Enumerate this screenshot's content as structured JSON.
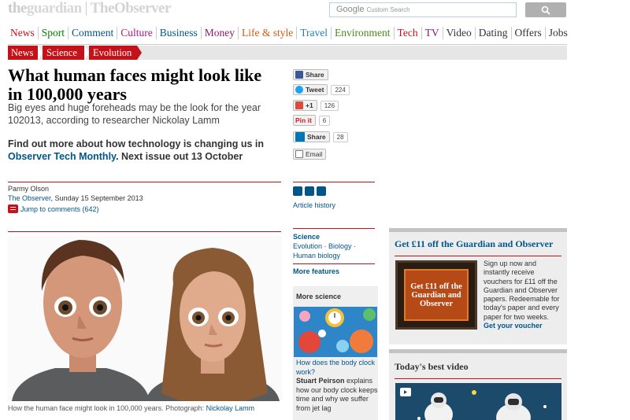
{
  "header": {
    "logo_the": "the",
    "logo_name": "guardian",
    "logo_observer": "TheObserver",
    "search_brand": "Google",
    "search_placeholder": "Custom Search"
  },
  "nav": [
    {
      "label": "News",
      "color": "#c3121a"
    },
    {
      "label": "Sport",
      "color": "#008000"
    },
    {
      "label": "Comment",
      "color": "#005689"
    },
    {
      "label": "Culture",
      "color": "#b3158a"
    },
    {
      "label": "Business",
      "color": "#005689"
    },
    {
      "label": "Money",
      "color": "#8e1b6b"
    },
    {
      "label": "Life & style",
      "color": "#d35a14"
    },
    {
      "label": "Travel",
      "color": "#1b7fc1"
    },
    {
      "label": "Environment",
      "color": "#4a8a1c"
    },
    {
      "label": "Tech",
      "color": "#c3121a"
    },
    {
      "label": "TV",
      "color": "#8a1a6e"
    },
    {
      "label": "Video",
      "color": "#333333"
    },
    {
      "label": "Dating",
      "color": "#333333"
    },
    {
      "label": "Offers",
      "color": "#333333"
    },
    {
      "label": "Jobs",
      "color": "#333333"
    }
  ],
  "breadcrumbs": [
    "News",
    "Science",
    "Evolution"
  ],
  "article": {
    "headline": "What human faces might look like in 100,000 years",
    "standfirst": "Big eyes and huge foreheads may be the look for the year 102013, according to researcher Nickolay Lamm",
    "promo_pre": "Find out more about how technology is changing us in ",
    "promo_link": "Observer Tech Monthly",
    "promo_post": ". Next issue out 13 October",
    "author": "Parmy Olson",
    "publication": "The Observer",
    "date": ", Sunday 15 September 2013",
    "jump_to_comments": "Jump to comments (642)",
    "caption_pre": "How the human face might look in 100,000 years. Photograph: ",
    "caption_credit": "Nickolay Lamm"
  },
  "share": {
    "facebook": "Share",
    "twitter": "Tweet",
    "twitter_count": "224",
    "googleplus": "+1",
    "googleplus_count": "126",
    "pinterest": "Pin it",
    "pinterest_count": "6",
    "linkedin": "Share",
    "linkedin_count": "28",
    "email": "Email"
  },
  "sidebar": {
    "article_history": "Article history",
    "science_heading": "Science",
    "science_link1": "Evolution",
    "science_link2": "Biology",
    "science_link3": "Human biology",
    "more_features": "More features",
    "more_science": "More science",
    "ms_question": "How does the body clock work?",
    "ms_author": "Stuart Peirson",
    "ms_body": " explains how our body clock keeps time and why we suffer from jet lag"
  },
  "offer": {
    "heading": "Get £11 off the Guardian and Observer",
    "image_text": "Get £11 off the Guardian and Observer",
    "body": "Sign up now and instantly receive vouchers for £11 off the Guardian and Observer papers. Redeemable for today's paper and every paper for two weeks.",
    "cta": "Get your voucher"
  },
  "video": {
    "heading": "Today's best video"
  },
  "colors": {
    "guardian_red": "#c3121a",
    "link_blue": "#005689",
    "facebook": "#3b5998",
    "twitter": "#1da1f2",
    "googleplus": "#dd4b39",
    "pinterest": "#cb2027",
    "linkedin": "#0077b5"
  }
}
